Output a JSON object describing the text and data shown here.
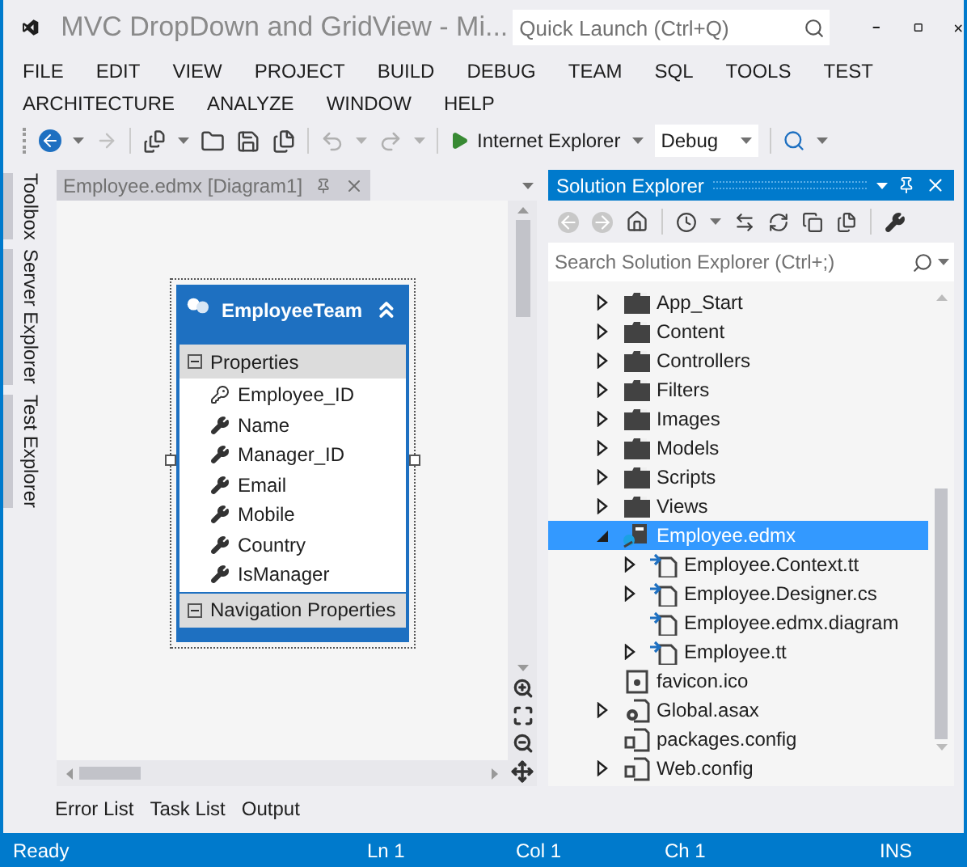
{
  "window": {
    "title": "MVC DropDown and GridView - Mi...",
    "quick_launch": {
      "placeholder": "Quick Launch (Ctrl+Q)"
    }
  },
  "menu": [
    "FILE",
    "EDIT",
    "VIEW",
    "PROJECT",
    "BUILD",
    "DEBUG",
    "TEAM",
    "SQL",
    "TOOLS",
    "TEST",
    "ARCHITECTURE",
    "ANALYZE",
    "WINDOW",
    "HELP"
  ],
  "toolbar": {
    "run_target": "Internet Explorer",
    "configuration": "Debug"
  },
  "side_tabs": [
    "Toolbox",
    "Server Explorer",
    "Test Explorer"
  ],
  "document_tab": {
    "title": "Employee.edmx [Diagram1]"
  },
  "entity": {
    "name": "EmployeeTeam",
    "sections": [
      {
        "title": "Properties",
        "expanded": true,
        "properties": [
          {
            "name": "Employee_ID",
            "key": true
          },
          {
            "name": "Name",
            "key": false
          },
          {
            "name": "Manager_ID",
            "key": false
          },
          {
            "name": "Email",
            "key": false
          },
          {
            "name": "Mobile",
            "key": false
          },
          {
            "name": "Country",
            "key": false
          },
          {
            "name": "IsManager",
            "key": false
          }
        ]
      },
      {
        "title": "Navigation Properties",
        "expanded": true
      }
    ]
  },
  "solution_explorer": {
    "title": "Solution Explorer",
    "search": {
      "placeholder": "Search Solution Explorer (Ctrl+;)"
    },
    "tree": [
      {
        "label": "App_Start",
        "kind": "folder",
        "expandable": true,
        "expanded": false,
        "selected": false
      },
      {
        "label": "Content",
        "kind": "folder",
        "expandable": true,
        "expanded": false,
        "selected": false
      },
      {
        "label": "Controllers",
        "kind": "folder",
        "expandable": true,
        "expanded": false,
        "selected": false
      },
      {
        "label": "Filters",
        "kind": "folder",
        "expandable": true,
        "expanded": false,
        "selected": false
      },
      {
        "label": "Images",
        "kind": "folder",
        "expandable": true,
        "expanded": false,
        "selected": false
      },
      {
        "label": "Models",
        "kind": "folder",
        "expandable": true,
        "expanded": false,
        "selected": false
      },
      {
        "label": "Scripts",
        "kind": "folder",
        "expandable": true,
        "expanded": false,
        "selected": false
      },
      {
        "label": "Views",
        "kind": "folder",
        "expandable": true,
        "expanded": false,
        "selected": false
      },
      {
        "label": "Employee.edmx",
        "kind": "model",
        "expandable": true,
        "expanded": true,
        "selected": true,
        "children": [
          {
            "label": "Employee.Context.tt",
            "kind": "generated",
            "expandable": true,
            "expanded": false,
            "selected": false
          },
          {
            "label": "Employee.Designer.cs",
            "kind": "generated",
            "expandable": true,
            "expanded": false,
            "selected": false
          },
          {
            "label": "Employee.edmx.diagram",
            "kind": "generated",
            "expandable": false,
            "selected": false
          },
          {
            "label": "Employee.tt",
            "kind": "generated",
            "expandable": true,
            "expanded": false,
            "selected": false
          }
        ]
      },
      {
        "label": "favicon.ico",
        "kind": "image",
        "expandable": false,
        "selected": false
      },
      {
        "label": "Global.asax",
        "kind": "code",
        "expandable": true,
        "expanded": false,
        "selected": false
      },
      {
        "label": "packages.config",
        "kind": "config",
        "expandable": false,
        "selected": false
      },
      {
        "label": "Web.config",
        "kind": "config",
        "expandable": true,
        "expanded": false,
        "selected": false
      }
    ]
  },
  "bottom_tabs": [
    "Error List",
    "Task List",
    "Output"
  ],
  "status_bar": {
    "message": "Ready",
    "line": "Ln 1",
    "column": "Col 1",
    "char": "Ch 1",
    "mode": "INS"
  }
}
